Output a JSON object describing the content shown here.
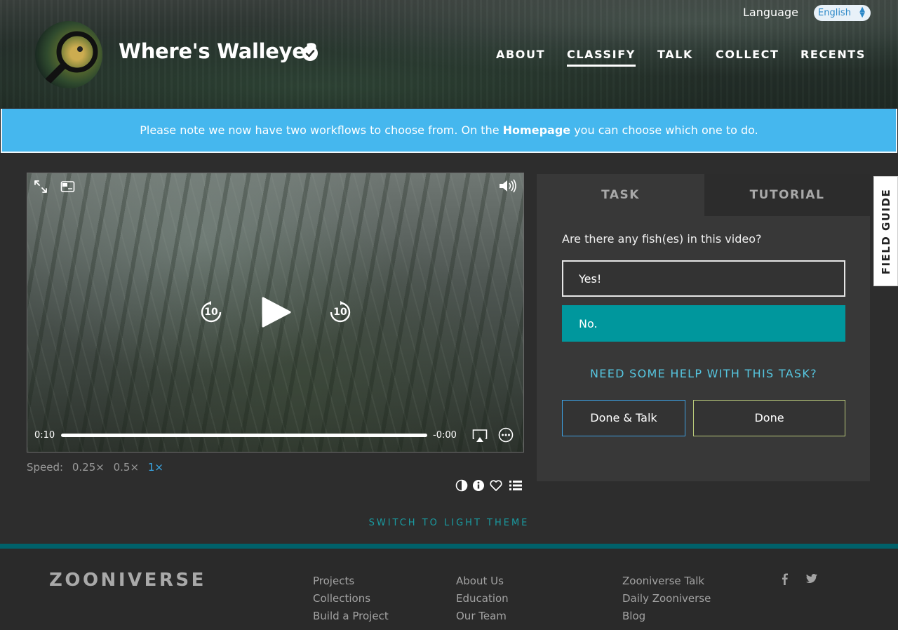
{
  "header": {
    "project_title": "Where's Walleye?",
    "language_label": "Language",
    "language_value": "English",
    "nav": [
      {
        "label": "ABOUT"
      },
      {
        "label": "CLASSIFY",
        "active": true
      },
      {
        "label": "TALK"
      },
      {
        "label": "COLLECT"
      },
      {
        "label": "RECENTS"
      }
    ]
  },
  "banner": {
    "text_before": "Please note we now have two workflows to choose from. On the ",
    "link_text": "Homepage",
    "text_after": " you can choose which one to do."
  },
  "video": {
    "time_elapsed": "0:10",
    "time_remaining": "-0:00",
    "progress": 1.0,
    "rewind_seconds": "10",
    "forward_seconds": "10"
  },
  "speed": {
    "label": "Speed:",
    "options": [
      "0.25×",
      "0.5×",
      "1×"
    ],
    "selected": "1×"
  },
  "task": {
    "tabs": [
      "TASK",
      "TUTORIAL"
    ],
    "question": "Are there any fish(es) in this video?",
    "answers": [
      "Yes!",
      "No."
    ],
    "help_link": "NEED SOME HELP WITH THIS TASK?",
    "done_talk_label": "Done & Talk",
    "done_label": "Done"
  },
  "field_guide_label": "FIELD GUIDE",
  "theme_switch_label": "SWITCH TO LIGHT THEME",
  "footer": {
    "logo": "ZOONIVERSE",
    "col1": [
      "Projects",
      "Collections",
      "Build a Project"
    ],
    "col2": [
      "About Us",
      "Education",
      "Our Team"
    ],
    "col3": [
      "Zooniverse Talk",
      "Daily Zooniverse",
      "Blog"
    ],
    "social": [
      "facebook-icon",
      "twitter-icon"
    ]
  },
  "colors": {
    "banner": "#45b7ee",
    "answer_selected": "#00979d",
    "accent_teal": "#1a9aa0",
    "done_talk_border": "#3d9fe0",
    "done_border": "#b9c97a"
  }
}
